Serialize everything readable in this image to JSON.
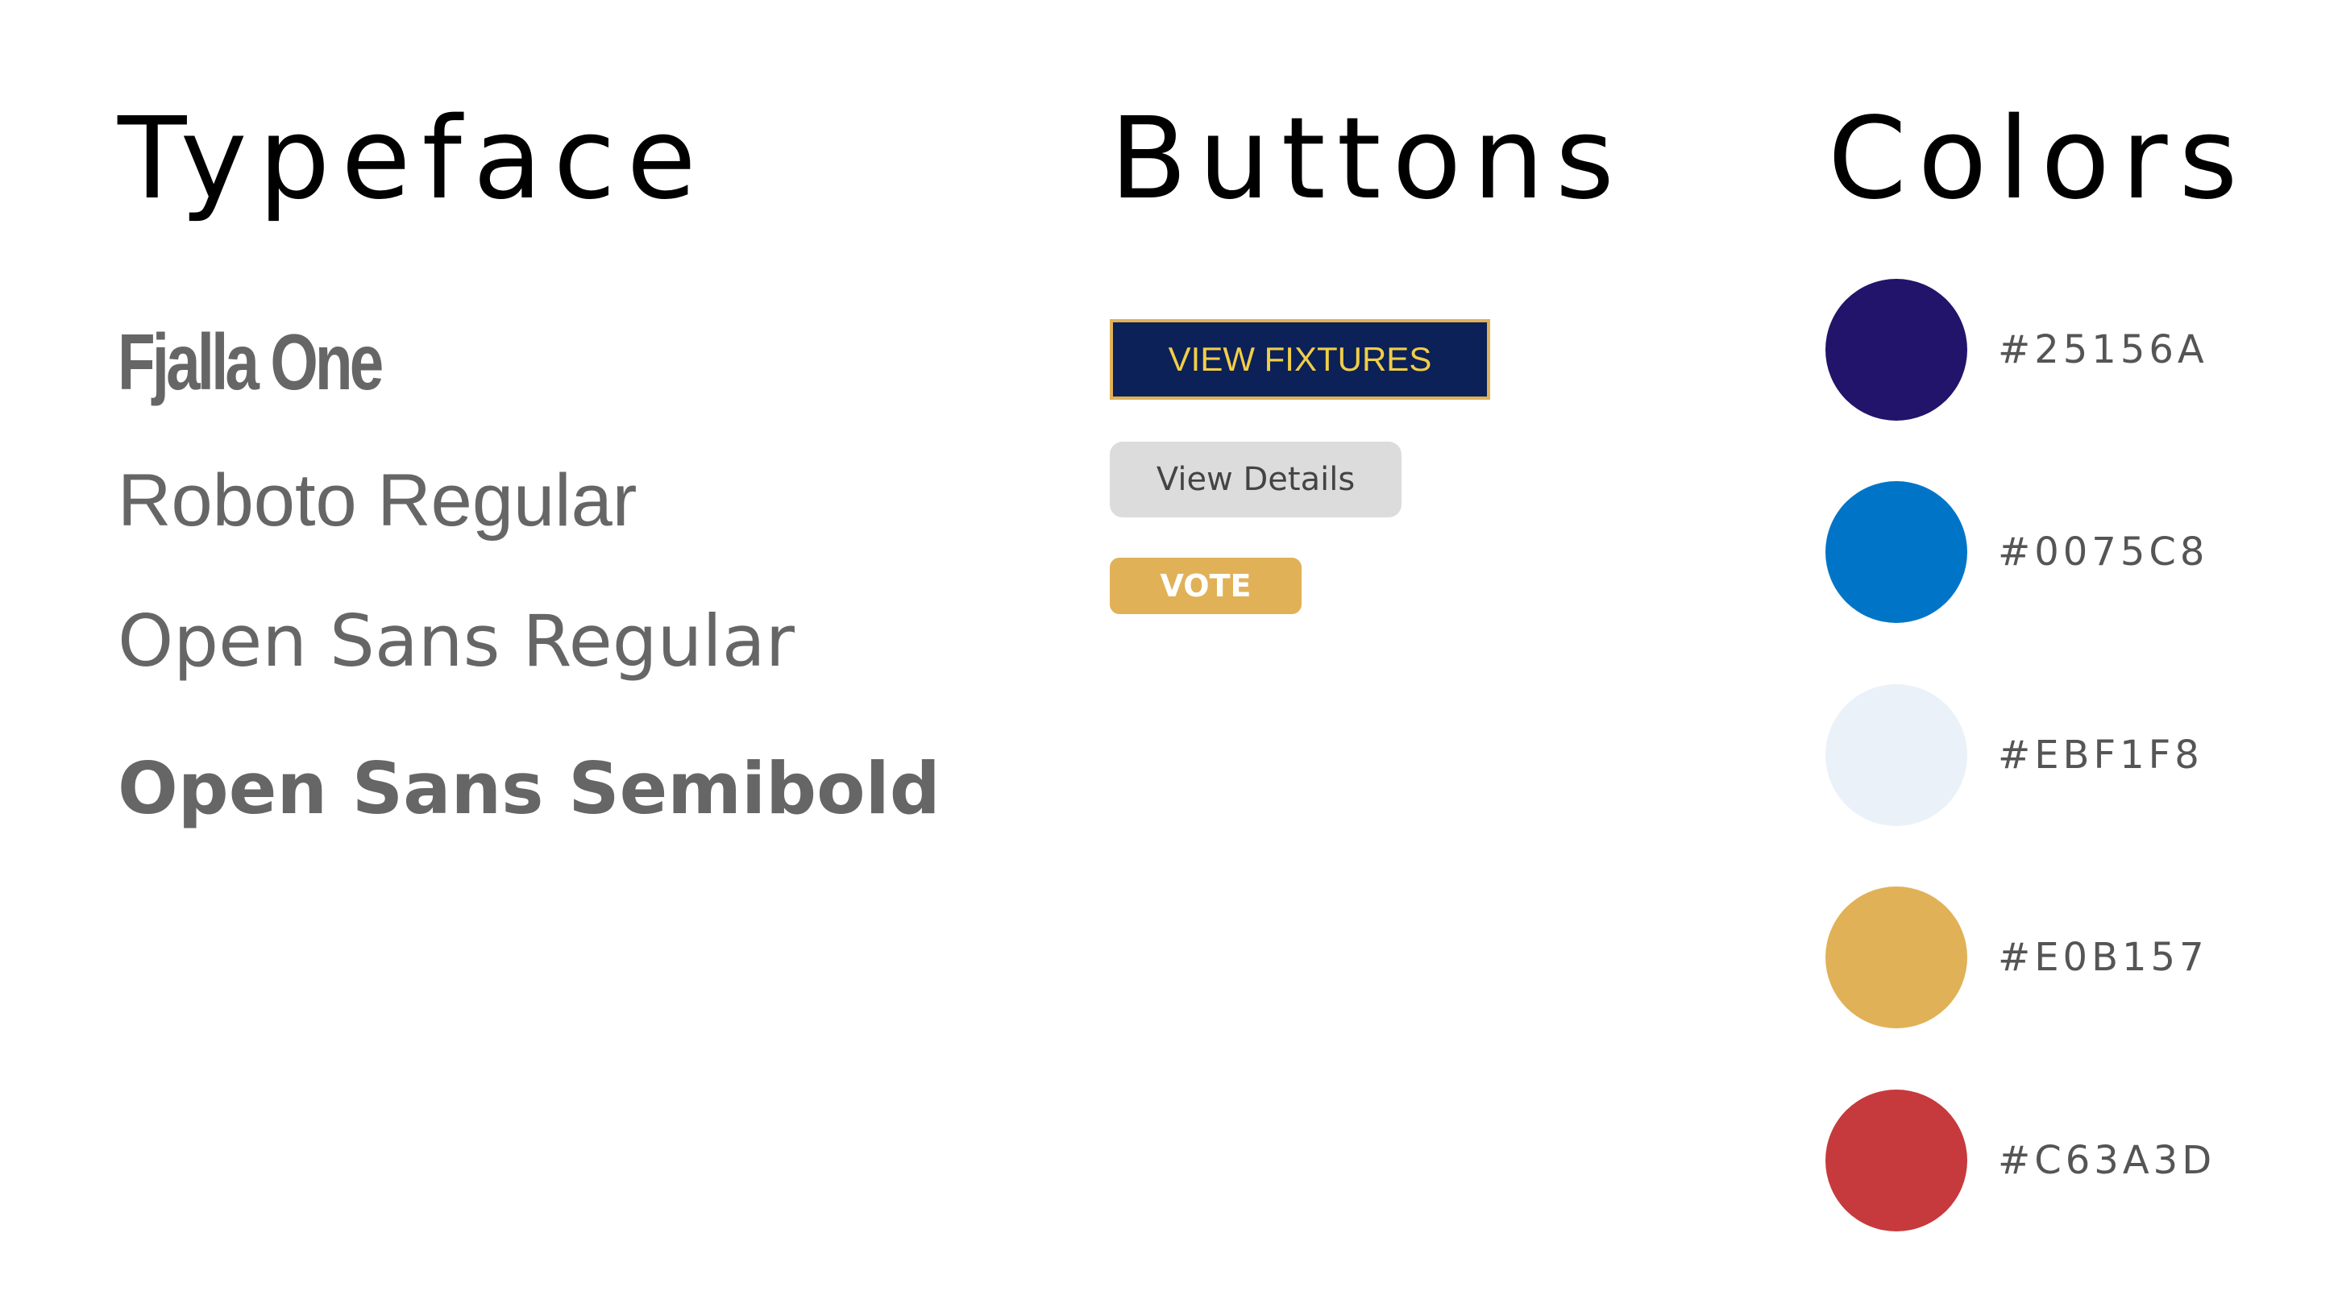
{
  "typeface": {
    "heading": "Typeface",
    "samples": [
      "Fjalla One",
      "Roboto Regular",
      "Open Sans Regular",
      "Open Sans Semibold"
    ]
  },
  "buttons": {
    "heading": "Buttons",
    "view_fixtures": "VIEW FIXTURES",
    "view_details": "View Details",
    "vote": "VOTE"
  },
  "colors": {
    "heading": "Colors",
    "swatches": [
      {
        "hex": "#25156A",
        "color": "#22146a"
      },
      {
        "hex": "#0075C8",
        "color": "#0075c8"
      },
      {
        "hex": "#EBF1F8",
        "color": "#ebf1f8"
      },
      {
        "hex": "#E0B157",
        "color": "#e0b157"
      },
      {
        "hex": "#C63A3D",
        "color": "#c63a3d"
      }
    ]
  },
  "accent_colors": {
    "fixtures_button_bg": "#0b2157",
    "fixtures_button_text": "#f2cd47",
    "details_button_bg": "#dcdcdc",
    "vote_button_bg": "#e0b157",
    "sample_text": "#666666"
  }
}
